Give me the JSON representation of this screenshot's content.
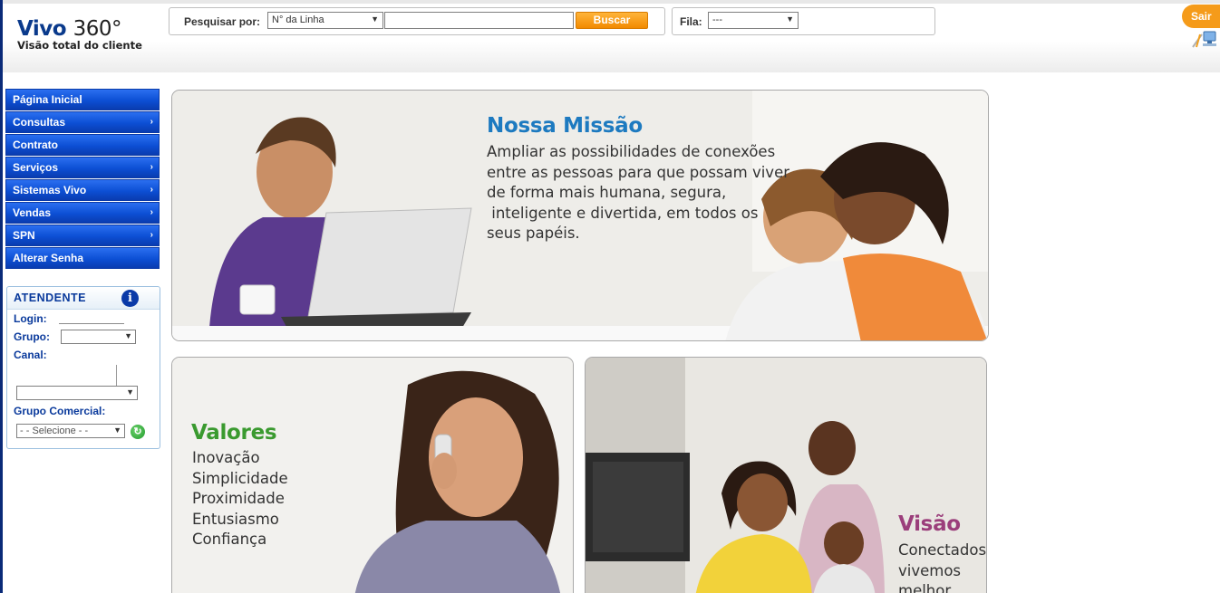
{
  "header": {
    "logo_title": "Vivo ",
    "logo_number": "360°",
    "logo_subtitle": "Visão total do cliente",
    "search": {
      "label": "Pesquisar por:",
      "type_value": "N° da Linha",
      "input_value": "",
      "button_label": "Buscar"
    },
    "fila": {
      "label": "Fila:",
      "value": "---"
    },
    "logout_label": "Sair"
  },
  "menu": {
    "items": [
      {
        "label": "Página Inicial",
        "has_submenu": false
      },
      {
        "label": "Consultas",
        "has_submenu": true
      },
      {
        "label": "Contrato",
        "has_submenu": false
      },
      {
        "label": "Serviços",
        "has_submenu": true
      },
      {
        "label": "Sistemas Vivo",
        "has_submenu": true
      },
      {
        "label": "Vendas",
        "has_submenu": true
      },
      {
        "label": "SPN",
        "has_submenu": true
      },
      {
        "label": "Alterar Senha",
        "has_submenu": false
      }
    ],
    "chevron": "›"
  },
  "attendant": {
    "title": "ATENDENTE",
    "login_label": "Login:",
    "grupo_label": "Grupo:",
    "grupo_value": "",
    "canal_label": "Canal:",
    "canal_value": "",
    "grupo_comercial_label": "Grupo Comercial:",
    "grupo_comercial_value": "- - Selecione - -"
  },
  "banners": {
    "mission": {
      "title": "Nossa Missão",
      "text": "Ampliar as possibilidades de conexões\nentre as pessoas para que possam viver\nde forma mais humana, segura,\n inteligente e divertida, em todos os\nseus papéis."
    },
    "values": {
      "title": "Valores",
      "text": "Inovação\nSimplicidade\nProximidade\nEntusiasmo\nConfiança"
    },
    "vision": {
      "title": "Visão",
      "text": "Conectados\nvivemos\nmelhor"
    }
  },
  "colors": {
    "brand_blue": "#0a3a8c",
    "menu_blue": "#0c4fd4",
    "button_orange": "#f28a00",
    "mission_title": "#1d7ac0",
    "values_title": "#3a9a2f",
    "vision_title": "#9b3e7b"
  }
}
